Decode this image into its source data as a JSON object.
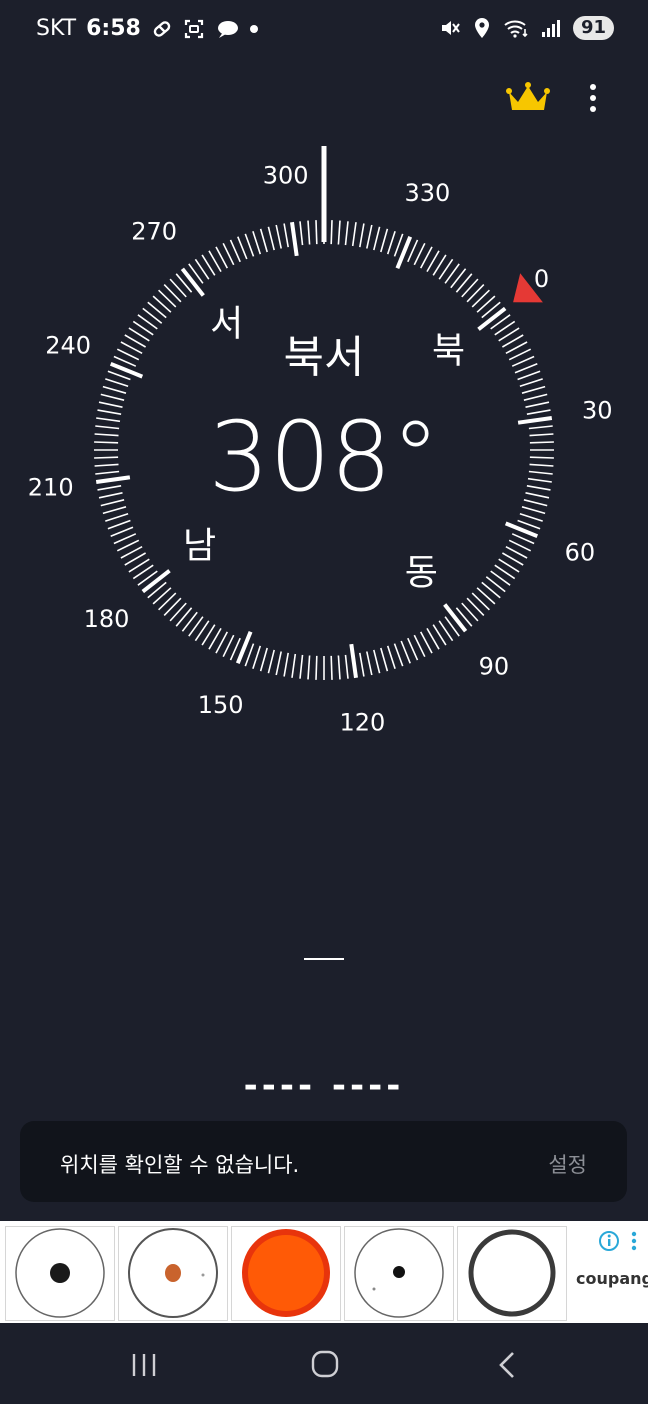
{
  "status_bar": {
    "carrier": "SKT",
    "time": "6:58",
    "battery": "91",
    "left_icons": [
      "pill-icon",
      "scan-icon",
      "chat-bubble-icon",
      "dot-icon"
    ],
    "right_icons": [
      "mute-icon",
      "location-icon",
      "wifi-icon",
      "signal-icon"
    ]
  },
  "toolbar": {
    "icons": [
      "crown-icon",
      "more-vert-icon"
    ],
    "crown_color": "#f7c600"
  },
  "compass": {
    "direction_label": "북서",
    "heading": "308°",
    "heading_value": 308,
    "cardinals": {
      "north": "북",
      "east": "동",
      "south": "남",
      "west": "서"
    },
    "degree_labels": [
      "0",
      "30",
      "60",
      "90",
      "120",
      "150",
      "180",
      "210",
      "240",
      "270",
      "300",
      "330"
    ],
    "north_marker_color": "#e53935"
  },
  "altitude_placeholder": "—",
  "coordinates_placeholder": "---- ----",
  "toast": {
    "message": "위치를 확인할 수 없습니다.",
    "action_label": "설정"
  },
  "ad": {
    "brand": "coupang",
    "item_icons": [
      "plate-black-dot-icon",
      "plate-orange-dot-icon",
      "orange-plate-icon",
      "plate-small-dot-icon",
      "ring-plate-icon"
    ],
    "info_icon": "info-icon",
    "menu_icon": "more-vert-icon"
  },
  "nav_bar": {
    "icons": [
      "recents-icon",
      "home-icon",
      "back-icon"
    ]
  }
}
